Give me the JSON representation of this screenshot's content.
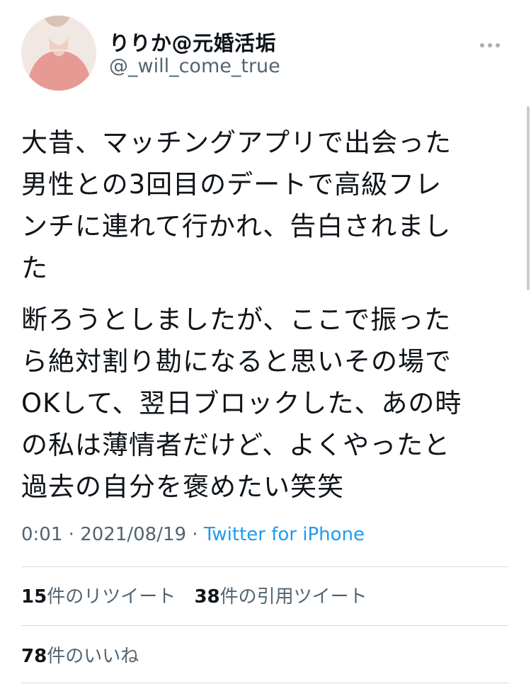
{
  "user": {
    "display_name": "りりか@元婚活垢",
    "handle": "@_will_come_true"
  },
  "more_icon": "more-horizontal-icon",
  "tweet": {
    "paragraphs": [
      "大昔、マッチングアプリで出会った\n男性との3回目のデートで高級フレ\nンチに連れて行かれ、告白されまし\nた",
      "断ろうとしましたが、ここで振った\nら絶対割り勘になると思いその場で\nOKして、翌日ブロックした、あの時\nの私は薄情者だけど、よくやったと\n過去の自分を褒めたい笑笑"
    ]
  },
  "meta": {
    "time": "0:01",
    "separator": " · ",
    "date": "2021/08/19",
    "app": "Twitter for iPhone"
  },
  "stats": {
    "retweets_count": "15",
    "retweets_label": "件のリツイート",
    "quotes_count": "38",
    "quotes_label": "件の引用ツイート",
    "likes_count": "78",
    "likes_label": "件のいいね"
  },
  "colors": {
    "link": "#1d9bf0",
    "secondary_text": "#536471",
    "avatar_top": "#f2e8e3",
    "avatar_shirt": "#e79a93"
  }
}
